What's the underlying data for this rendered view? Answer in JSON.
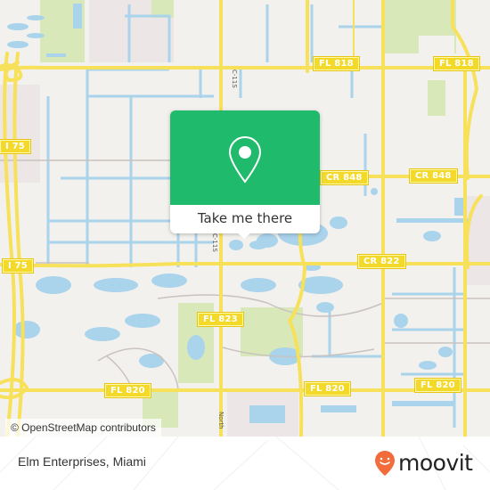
{
  "map": {
    "road_labels": [
      {
        "id": "fl818-a",
        "text": "FL 818"
      },
      {
        "id": "fl818-b",
        "text": "FL 818"
      },
      {
        "id": "i75-a",
        "text": "I 75"
      },
      {
        "id": "i75-b",
        "text": "I 75"
      },
      {
        "id": "cr848-a",
        "text": "CR 848"
      },
      {
        "id": "cr848-b",
        "text": "CR 848"
      },
      {
        "id": "cr822",
        "text": "CR 822"
      },
      {
        "id": "fl823",
        "text": "FL 823"
      },
      {
        "id": "fl820-a",
        "text": "FL 820"
      },
      {
        "id": "fl820-b",
        "text": "FL 820"
      },
      {
        "id": "fl820-c",
        "text": "FL 820"
      }
    ],
    "street_labels": [
      {
        "id": "c11s",
        "text": "C-11S"
      },
      {
        "id": "c11s-lower",
        "text": "C-11S"
      },
      {
        "id": "north",
        "text": "North"
      }
    ],
    "colors": {
      "land": "#f2f1ed",
      "water": "#aad3ec",
      "park": "#d8e8b8",
      "road": "#f7e05a",
      "road_label": "#f3d92a",
      "minor_road": "#c9c2c0",
      "urban": "#ece6e6"
    },
    "attribution": "© OpenStreetMap contributors"
  },
  "popup": {
    "icon": "location-pin-icon",
    "action_label": "Take me there",
    "color": "#1fba6b"
  },
  "footer": {
    "place_name": "Elm Enterprises, Miami",
    "brand": "moovit",
    "brand_icon": "moovit-logo-icon",
    "brand_color": "#f26b3a"
  }
}
